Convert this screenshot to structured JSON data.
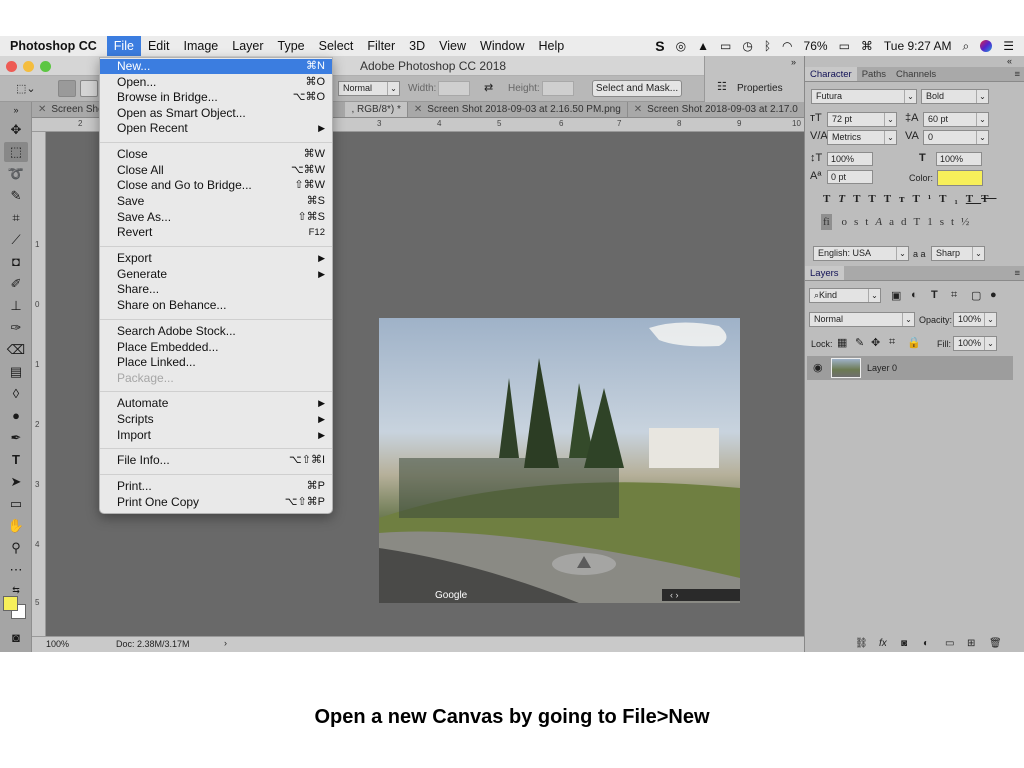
{
  "menubar": {
    "app_name": "Photoshop CC",
    "items": [
      "File",
      "Edit",
      "Image",
      "Layer",
      "Type",
      "Select",
      "Filter",
      "3D",
      "View",
      "Window",
      "Help"
    ],
    "battery": "76%",
    "clock": "Tue 9:27 AM"
  },
  "window": {
    "title": "Adobe Photoshop CC 2018"
  },
  "options_bar": {
    "style_value": "Normal",
    "width_label": "Width:",
    "height_label": "Height:",
    "select_mask_label": "Select and Mask..."
  },
  "properties_panel": {
    "label": "Properties"
  },
  "tabs": [
    {
      "label": "Screen Shot"
    },
    {
      "label": ", RGB/8*) *"
    },
    {
      "label": "Screen Shot 2018-09-03 at 2.16.50 PM.png"
    },
    {
      "label": "Screen Shot 2018-09-03 at 2.17.0"
    }
  ],
  "ruler_top": [
    "2",
    "1",
    "2",
    "3",
    "4",
    "5",
    "6",
    "7",
    "8",
    "9",
    "10"
  ],
  "ruler_left": [
    "1",
    "0",
    "1",
    "2",
    "3",
    "4",
    "5",
    "6"
  ],
  "file_menu": {
    "items": [
      {
        "label": "New...",
        "shortcut": "⌘N",
        "highlight": true
      },
      {
        "label": "Open...",
        "shortcut": "⌘O"
      },
      {
        "label": "Browse in Bridge...",
        "shortcut": "⌥⌘O"
      },
      {
        "label": "Open as Smart Object..."
      },
      {
        "label": "Open Recent",
        "submenu": "▶"
      },
      {
        "label": "Close",
        "shortcut": "⌘W"
      },
      {
        "label": "Close All",
        "shortcut": "⌥⌘W"
      },
      {
        "label": "Close and Go to Bridge...",
        "shortcut": "⇧⌘W"
      },
      {
        "label": "Save",
        "shortcut": "⌘S"
      },
      {
        "label": "Save As...",
        "shortcut": "⇧⌘S"
      },
      {
        "label": "Revert",
        "shortcut": "F12"
      },
      {
        "label": "Export",
        "submenu": "▶"
      },
      {
        "label": "Generate",
        "submenu": "▶"
      },
      {
        "label": "Share..."
      },
      {
        "label": "Share on Behance..."
      },
      {
        "label": "Search Adobe Stock..."
      },
      {
        "label": "Place Embedded..."
      },
      {
        "label": "Place Linked..."
      },
      {
        "label": "Package...",
        "disabled": true
      },
      {
        "label": "Automate",
        "submenu": "▶"
      },
      {
        "label": "Scripts",
        "submenu": "▶"
      },
      {
        "label": "Import",
        "submenu": "▶"
      },
      {
        "label": "File Info...",
        "shortcut": "⌥⇧⌘I"
      },
      {
        "label": "Print...",
        "shortcut": "⌘P"
      },
      {
        "label": "Print One Copy",
        "shortcut": "⌥⇧⌘P"
      }
    ]
  },
  "canvas": {
    "watermark": "Google"
  },
  "status_bar": {
    "zoom": "100%",
    "doc_size": "Doc: 2.38M/3.17M"
  },
  "character_panel": {
    "tabs": [
      "Character",
      "Paths",
      "Channels"
    ],
    "font_family": "Futura",
    "font_style": "Bold",
    "font_size": "72 pt",
    "leading": "60 pt",
    "kerning": "Metrics",
    "tracking": "0",
    "vertical_scale": "100%",
    "horizontal_scale": "100%",
    "baseline_shift": "0 pt",
    "color_label": "Color:",
    "text_color": "#f7ef5a",
    "language": "English: USA",
    "anti_alias": "Sharp",
    "aa_label": "a a"
  },
  "layers_panel": {
    "tab": "Layers",
    "filter": "Kind",
    "blend_mode": "Normal",
    "opacity_label": "Opacity:",
    "opacity": "100%",
    "lock_label": "Lock:",
    "fill_label": "Fill:",
    "fill": "100%",
    "layers": [
      {
        "name": "Layer 0"
      }
    ]
  },
  "caption": "Open a new Canvas by going to File>New",
  "colors": {
    "highlight": "#3b7de0",
    "foreground_swatch": "#f7ef5a",
    "background_swatch": "#ffffff"
  }
}
